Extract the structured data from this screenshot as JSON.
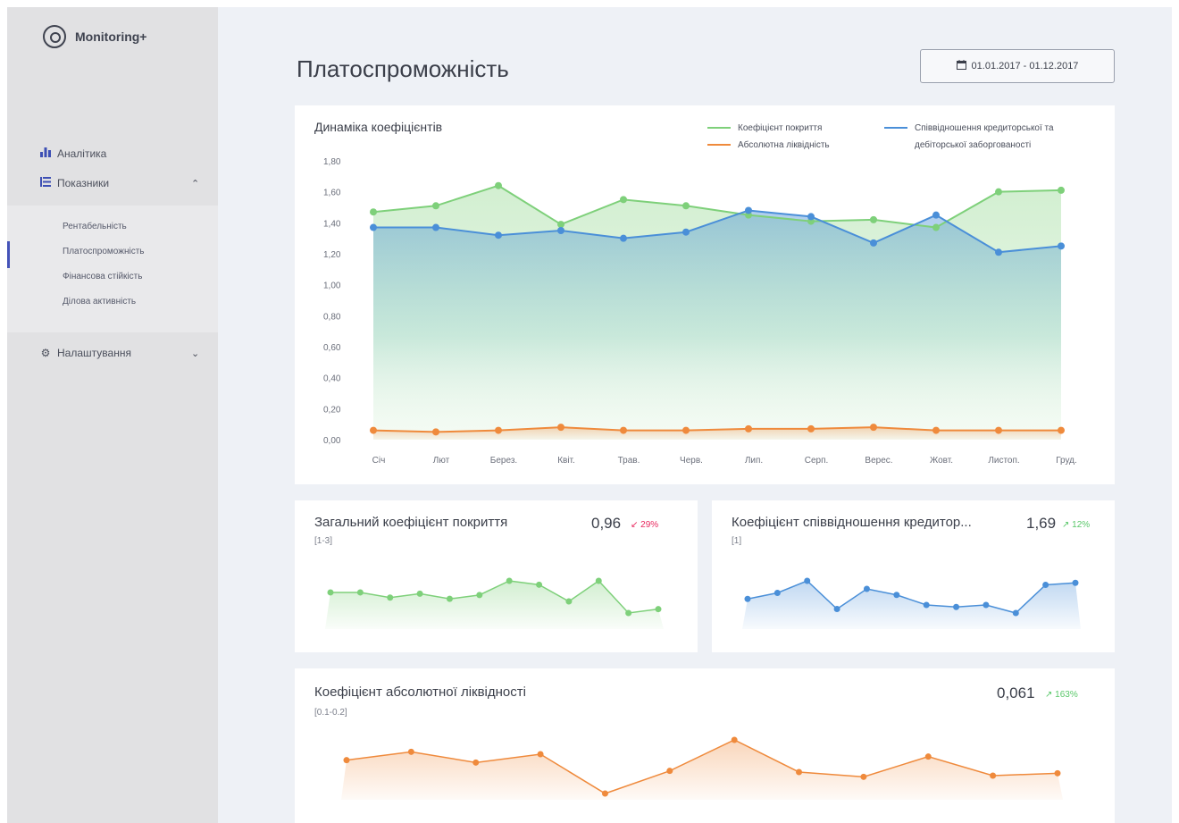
{
  "app": {
    "name": "Monitoring+"
  },
  "sidebar": {
    "items": [
      {
        "label": "Аналітика",
        "icon": "bar-chart-icon"
      },
      {
        "label": "Показники",
        "icon": "list-icon",
        "expanded": true
      },
      {
        "label": "Налаштування",
        "icon": "gear-icon",
        "expanded": false
      }
    ],
    "subitems": [
      {
        "label": "Рентабельність"
      },
      {
        "label": "Платоспроможність",
        "active": true
      },
      {
        "label": "Фінансова стійкість"
      },
      {
        "label": "Ділова активність"
      }
    ]
  },
  "header": {
    "title": "Платоспроможність",
    "date_range": "01.01.2017 - 01.12.2017"
  },
  "colors": {
    "green": "#7ed07a",
    "blue": "#4a8fd8",
    "orange": "#ef8a3c",
    "negative": "#e8285e",
    "positive": "#5ac86a",
    "accent": "#4452b8"
  },
  "chart_data": [
    {
      "type": "area",
      "title": "Динаміка коефіцієнтів",
      "categories": [
        "Січ",
        "Лют",
        "Берез.",
        "Квіт.",
        "Трав.",
        "Черв.",
        "Лип.",
        "Серп.",
        "Верес.",
        "Жовт.",
        "Листоп.",
        "Груд."
      ],
      "yticks": [
        "0,00",
        "0,20",
        "0,40",
        "0,60",
        "0,80",
        "1,00",
        "1,20",
        "1,40",
        "1,60",
        "1,80"
      ],
      "ylim": [
        0,
        1.8
      ],
      "legend_position": "top-right",
      "series": [
        {
          "name": "Коефіцієнт покриття",
          "color": "#7ed07a",
          "values": [
            1.47,
            1.51,
            1.64,
            1.39,
            1.55,
            1.51,
            1.45,
            1.41,
            1.42,
            1.37,
            1.6,
            1.61
          ]
        },
        {
          "name": "Співвідношення кредиторської та дебіторської заборгованості",
          "color": "#4a8fd8",
          "values": [
            1.37,
            1.37,
            1.32,
            1.35,
            1.3,
            1.34,
            1.48,
            1.44,
            1.27,
            1.45,
            1.21,
            1.25
          ]
        },
        {
          "name": "Абсолютна ліквідність",
          "color": "#ef8a3c",
          "values": [
            0.06,
            0.05,
            0.06,
            0.08,
            0.06,
            0.06,
            0.07,
            0.07,
            0.08,
            0.06,
            0.06,
            0.06
          ]
        }
      ]
    },
    {
      "type": "area",
      "title": "Загальний коефіцієнт покриття",
      "range": "[1-3]",
      "value": "0,96",
      "change": "29%",
      "direction": "down",
      "color": "#7ed07a",
      "values": [
        1.0,
        1.0,
        0.96,
        0.99,
        0.95,
        0.98,
        1.09,
        1.06,
        0.93,
        1.09,
        0.84,
        0.87
      ]
    },
    {
      "type": "area",
      "title": "Коефіцієнт співвідношення кредитор...",
      "range": "[1]",
      "value": "1,69",
      "change": "12%",
      "direction": "up",
      "color": "#4a8fd8",
      "values": [
        1.6,
        1.63,
        1.69,
        1.55,
        1.65,
        1.62,
        1.57,
        1.56,
        1.57,
        1.53,
        1.67,
        1.68
      ]
    },
    {
      "type": "area",
      "title": "Коефіцієнт абсолютної ліквідності",
      "range": "[0.1-0.2]",
      "value": "0,061",
      "change": "163%",
      "direction": "up",
      "color": "#ef8a3c",
      "values": [
        0.115,
        0.122,
        0.113,
        0.12,
        0.087,
        0.106,
        0.132,
        0.105,
        0.101,
        0.118,
        0.102,
        0.104
      ]
    }
  ]
}
